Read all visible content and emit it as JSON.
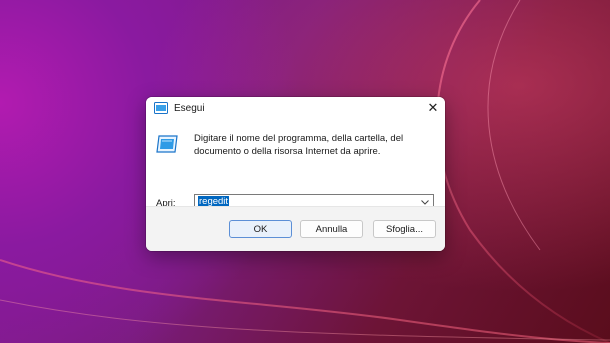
{
  "window": {
    "title": "Esegui",
    "close_glyph": "✕"
  },
  "dialog": {
    "description": "Digitare il nome del programma, della cartella, del documento o della risorsa Internet da aprire.",
    "open_label": "Apri:",
    "open_value": "regedit",
    "dropdown_icon": "chevron-down-icon"
  },
  "buttons": {
    "ok": "OK",
    "cancel": "Annulla",
    "browse": "Sfoglia..."
  },
  "colors": {
    "accent": "#0067c0",
    "dialog_bg": "#ffffff",
    "footer_bg": "#f3f3f3"
  }
}
